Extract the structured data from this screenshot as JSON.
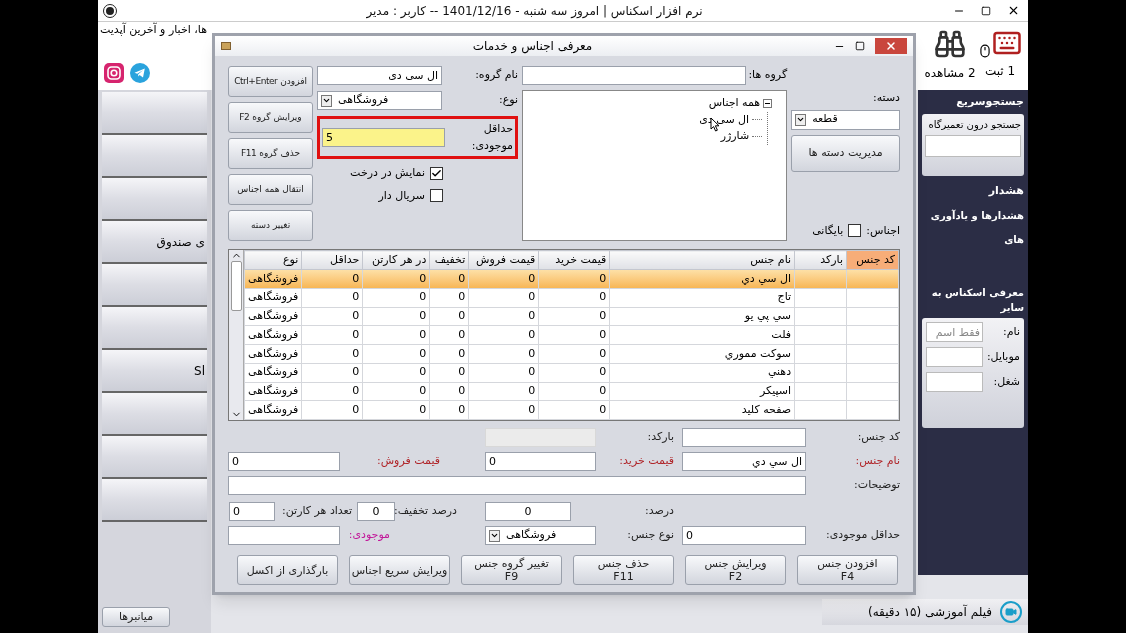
{
  "window": {
    "title": "نرم افزار اسکناس | امروز  سه شنبه - 1401/12/16 -- کاربر : مدیر"
  },
  "ticker": "ها، اخبار و آخرین آپدیت",
  "social": [
    {
      "kind": "instagram"
    },
    {
      "kind": "telegram"
    }
  ],
  "toolbar": [
    {
      "label": "1 ثبت",
      "kind": "keyboard"
    },
    {
      "label": "2 مشاهده",
      "kind": "binoculars"
    }
  ],
  "sidebar": {
    "items": [
      {
        "kind": "button"
      },
      {
        "kind": "button"
      },
      {
        "kind": "button"
      },
      {
        "kind": "button",
        "label": "ی صندوق"
      },
      {
        "kind": "button"
      },
      {
        "kind": "button"
      },
      {
        "kind": "button",
        "label": "Sl"
      },
      {
        "kind": "button"
      },
      {
        "kind": "button"
      },
      {
        "kind": "button"
      }
    ],
    "shortcuts_button": "میانبرها"
  },
  "right_panel": {
    "quick_search": {
      "title": "جستجوسریع",
      "label": "جستجو درون تعمیرگاه"
    },
    "alert": {
      "title": "هشدار",
      "text": "هشدارها و یادآوری های"
    },
    "introduce": {
      "title": "معرفی اسکناس به سایر",
      "fields": [
        {
          "label": "نام:",
          "placeholder": "فقط اسم"
        },
        {
          "label": "موبایل:"
        },
        {
          "label": "شغل:"
        }
      ]
    },
    "video": "فیلم آموزشی (۱۵ دقیقه)"
  },
  "dialog": {
    "title": "معرفی اجناس و خدمات",
    "category": {
      "label": "دسته:",
      "value": "قطعه",
      "manage_button": "مدیریت دسته ها"
    },
    "archive": {
      "label": "اجناس:",
      "option": "بایگانی",
      "checked": false
    },
    "groups": {
      "label": "گروه ها:",
      "tree": {
        "label": "همه اجناس",
        "expanded": true,
        "children": [
          {
            "label": "ال سی دی"
          },
          {
            "label": "شارژر"
          }
        ]
      }
    },
    "group_form": {
      "name_label": "نام گروه:",
      "name": "ال سی دی",
      "type_label": "نوع:",
      "type": "فروشگاهی",
      "min_label": "حداقل موجودی:",
      "min": "5",
      "highlighted": true,
      "checks": [
        {
          "label": "نمایش در درخت",
          "checked": true
        },
        {
          "label": "سریال دار",
          "checked": false
        }
      ]
    },
    "group_buttons": [
      "افزودن Ctrl+Enter",
      "ویرایش گروه F2",
      "حذف گروه F11",
      "انتقال همه اجناس",
      "تغییر دسته"
    ],
    "table": {
      "columns": [
        {
          "label": "کد جنس",
          "selected": true
        },
        {
          "label": "بارکد",
          "selected": false
        },
        {
          "label": "نام جنس",
          "selected": false
        },
        {
          "label": "قیمت خرید",
          "selected": false
        },
        {
          "label": "قیمت فروش",
          "selected": false
        },
        {
          "label": "تخفیف",
          "selected": false
        },
        {
          "label": "در هر کارتن",
          "selected": false
        },
        {
          "label": "حداقل",
          "selected": false
        },
        {
          "label": "نوع",
          "selected": false
        }
      ],
      "rows": [
        {
          "selected": true,
          "cells": [
            "",
            "",
            "ال سي دي",
            "0",
            "0",
            "0",
            "0",
            "0",
            "فروشگاهی"
          ]
        },
        {
          "selected": false,
          "cells": [
            "",
            "",
            "تاج",
            "0",
            "0",
            "0",
            "0",
            "0",
            "فروشگاهی"
          ]
        },
        {
          "selected": false,
          "cells": [
            "",
            "",
            "سي پي يو",
            "0",
            "0",
            "0",
            "0",
            "0",
            "فروشگاهی"
          ]
        },
        {
          "selected": false,
          "cells": [
            "",
            "",
            "فلت",
            "0",
            "0",
            "0",
            "0",
            "0",
            "فروشگاهی"
          ]
        },
        {
          "selected": false,
          "cells": [
            "",
            "",
            "سوکت مموري",
            "0",
            "0",
            "0",
            "0",
            "0",
            "فروشگاهی"
          ]
        },
        {
          "selected": false,
          "cells": [
            "",
            "",
            "دهني",
            "0",
            "0",
            "0",
            "0",
            "0",
            "فروشگاهی"
          ]
        },
        {
          "selected": false,
          "cells": [
            "",
            "",
            "اسپيکر",
            "0",
            "0",
            "0",
            "0",
            "0",
            "فروشگاهی"
          ]
        },
        {
          "selected": false,
          "cells": [
            "",
            "",
            "صفحه کليد",
            "0",
            "0",
            "0",
            "0",
            "0",
            "فروشگاهی"
          ]
        }
      ]
    },
    "form": {
      "code": {
        "label": "کد جنس:"
      },
      "barcode": {
        "label": "بارکد:",
        "disabled": true
      },
      "name": {
        "label": "نام جنس:",
        "color": "#b0262a",
        "value": "ال سي دي"
      },
      "buy": {
        "label": "قیمت خرید:",
        "color": "#b0262a",
        "value": "0"
      },
      "sell": {
        "label": "قیمت فروش:",
        "color": "#b0262a",
        "value": "0"
      },
      "notes": {
        "label": "توضیحات:"
      },
      "percent": {
        "label": "درصد:",
        "value": "0"
      },
      "discount": {
        "label": "درصد تخفیف:",
        "value": "0"
      },
      "carton": {
        "label": "تعداد هر کارتن:",
        "value": "0"
      },
      "min": {
        "label": "حداقل موجودی:",
        "value": "0"
      },
      "type": {
        "label": "نوع جنس:",
        "value": "فروشگاهی"
      },
      "stock": {
        "label": "موجودی:",
        "color": "#c2189a"
      }
    },
    "buttons": [
      {
        "label": "افزودن جنس",
        "shortcut": "F4"
      },
      {
        "label": "ویرایش جنس",
        "shortcut": "F2"
      },
      {
        "label": "حذف جنس",
        "shortcut": "F11"
      },
      {
        "label": "تغییر گروه جنس",
        "shortcut": "F9"
      },
      {
        "label": "ویرایش سریع اجناس"
      },
      {
        "label": "بارگذاری از اکسل"
      }
    ]
  }
}
